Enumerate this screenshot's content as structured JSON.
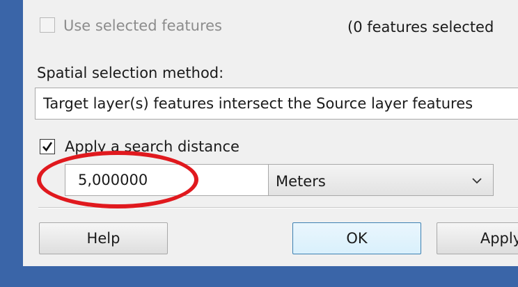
{
  "selected_features": {
    "checkbox_label": "Use selected features",
    "checked": false,
    "enabled": false,
    "count_text": "(0 features selected"
  },
  "spatial": {
    "label": "Spatial selection method:",
    "value": "Target layer(s) features intersect the Source layer features"
  },
  "search_distance": {
    "checkbox_label": "Apply a search distance",
    "checked": true,
    "value": "5,000000",
    "units": "Meters"
  },
  "buttons": {
    "help": "Help",
    "ok": "OK",
    "apply": "Apply"
  },
  "colors": {
    "highlight_ellipse": "#e0191e",
    "window_frame": "#3a65a8"
  }
}
